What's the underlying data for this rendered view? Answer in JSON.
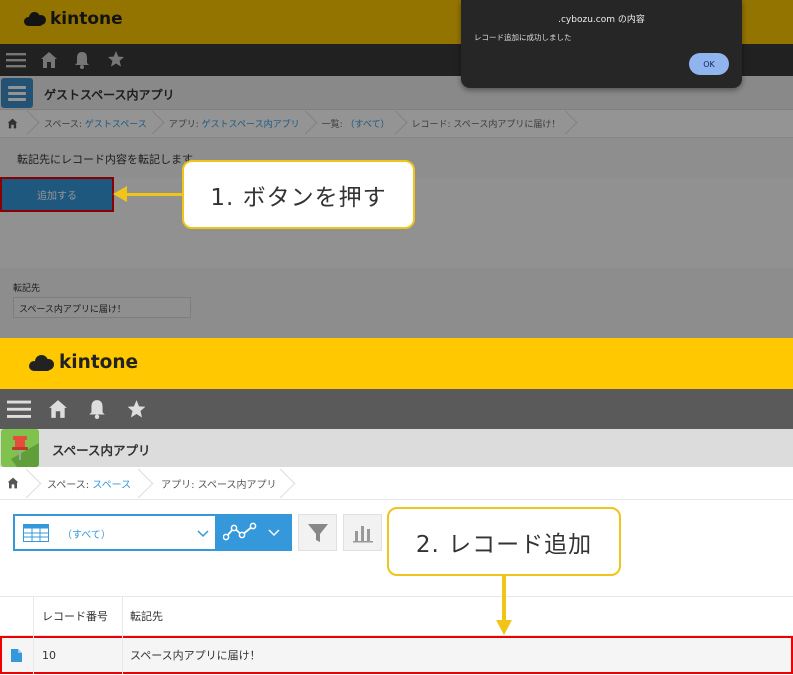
{
  "top": {
    "logo_text": "kintone",
    "app_name": "ゲストスペース内アプリ",
    "breadcrumbs": {
      "space_prefix": "スペース:",
      "space_link": "ゲストスペース",
      "app_prefix": "アプリ:",
      "app_link": "ゲストスペース内アプリ",
      "list_prefix": "一覧:",
      "list_link": "（すべて）",
      "record_label": "レコード: スペース内アプリに届け！"
    },
    "message": "転記先にレコード内容を転記します",
    "add_button": "追加する",
    "field_label": "転記先",
    "field_value": "スペース内アプリに届け！"
  },
  "dialog": {
    "title": ".cybozu.com の内容",
    "message": "レコード追加に成功しました",
    "ok_label": "OK"
  },
  "bottom": {
    "logo_text": "kintone",
    "app_name": "スペース内アプリ",
    "breadcrumbs": {
      "space_prefix": "スペース:",
      "space_link": "スペース",
      "app_label": "アプリ: スペース内アプリ"
    },
    "view_selector": "（すべて）",
    "table": {
      "headers": [
        "レコード番号",
        "転記先"
      ],
      "rows": [
        {
          "record_number": "10",
          "destination": "スペース内アプリに届け！"
        }
      ]
    }
  },
  "callouts": {
    "step1": "1. ボタンを押す",
    "step2": "2. レコード追加"
  },
  "colors": {
    "header_yellow": "#ffc800",
    "accent_blue": "#3498db",
    "highlight_red": "#ee0000",
    "callout_border": "#f0c419"
  }
}
